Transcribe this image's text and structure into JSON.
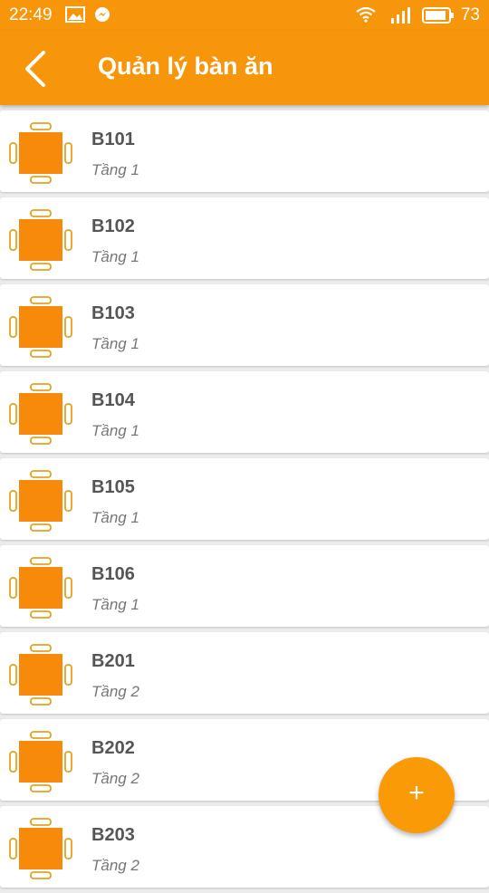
{
  "status_bar": {
    "time": "22:49",
    "battery": "73",
    "icons": [
      "image-icon",
      "messenger-icon",
      "wifi-icon",
      "signal-icon",
      "battery-icon"
    ]
  },
  "header": {
    "title": "Quản lý bàn ăn",
    "back_icon": "back-arrow-icon"
  },
  "tables": [
    {
      "name": "B101",
      "floor": "Tầng 1"
    },
    {
      "name": "B102",
      "floor": "Tầng 1"
    },
    {
      "name": "B103",
      "floor": "Tầng 1"
    },
    {
      "name": "B104",
      "floor": "Tầng 1"
    },
    {
      "name": "B105",
      "floor": "Tầng 1"
    },
    {
      "name": "B106",
      "floor": "Tầng 1"
    },
    {
      "name": "B201",
      "floor": "Tầng 2"
    },
    {
      "name": "B202",
      "floor": "Tầng 2"
    },
    {
      "name": "B203",
      "floor": "Tầng 2"
    }
  ],
  "fab": {
    "label": "+"
  },
  "colors": {
    "accent": "#f7960b",
    "table_fill": "#f7890b",
    "chair_stroke": "#e8a020"
  }
}
